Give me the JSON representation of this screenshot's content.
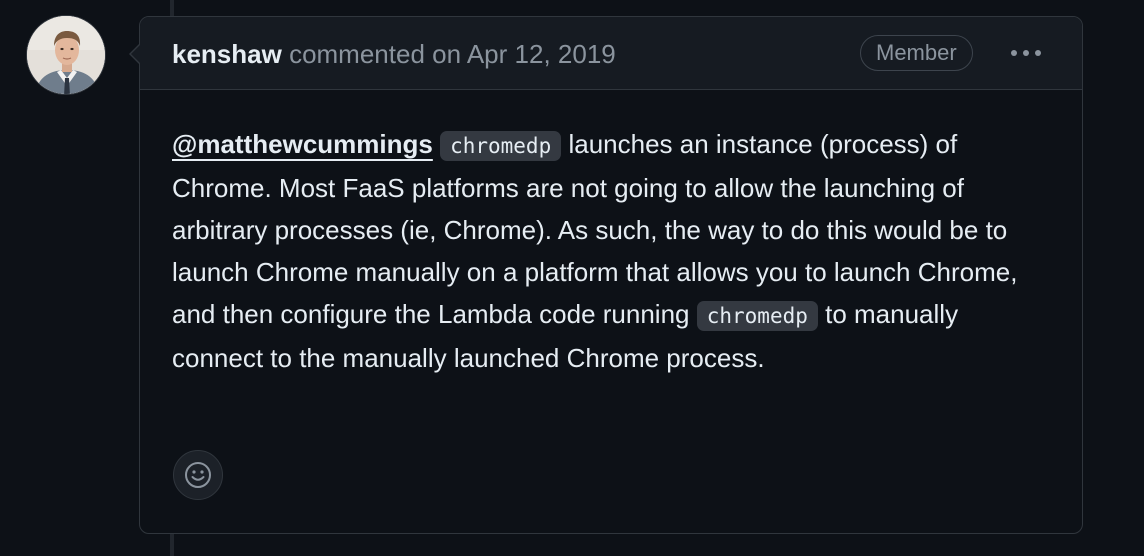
{
  "comment": {
    "author": "kenshaw",
    "action": "commented on",
    "timestamp": "Apr 12, 2019",
    "role_badge": "Member",
    "body": {
      "mention": "@matthewcummings",
      "code_1": "chromedp",
      "text_1": " launches an instance (process) of Chrome. Most FaaS platforms are not going to allow the launching of arbitrary processes (ie, Chrome). As such, the way to do this would be to launch Chrome manually on a platform that allows you to launch Chrome, and then configure the Lambda code running ",
      "code_2": "chromedp",
      "text_2": " to manually connect to the manually launched Chrome process."
    }
  },
  "icons": {
    "avatar": "user-avatar",
    "menu": "kebab-horizontal-icon",
    "reaction": "smiley-icon"
  },
  "colors": {
    "background": "#0d1117",
    "header_background": "#161b22",
    "border": "#30363d",
    "text_primary": "#e6edf3",
    "text_muted": "#8b949e",
    "code_background": "#343941"
  }
}
